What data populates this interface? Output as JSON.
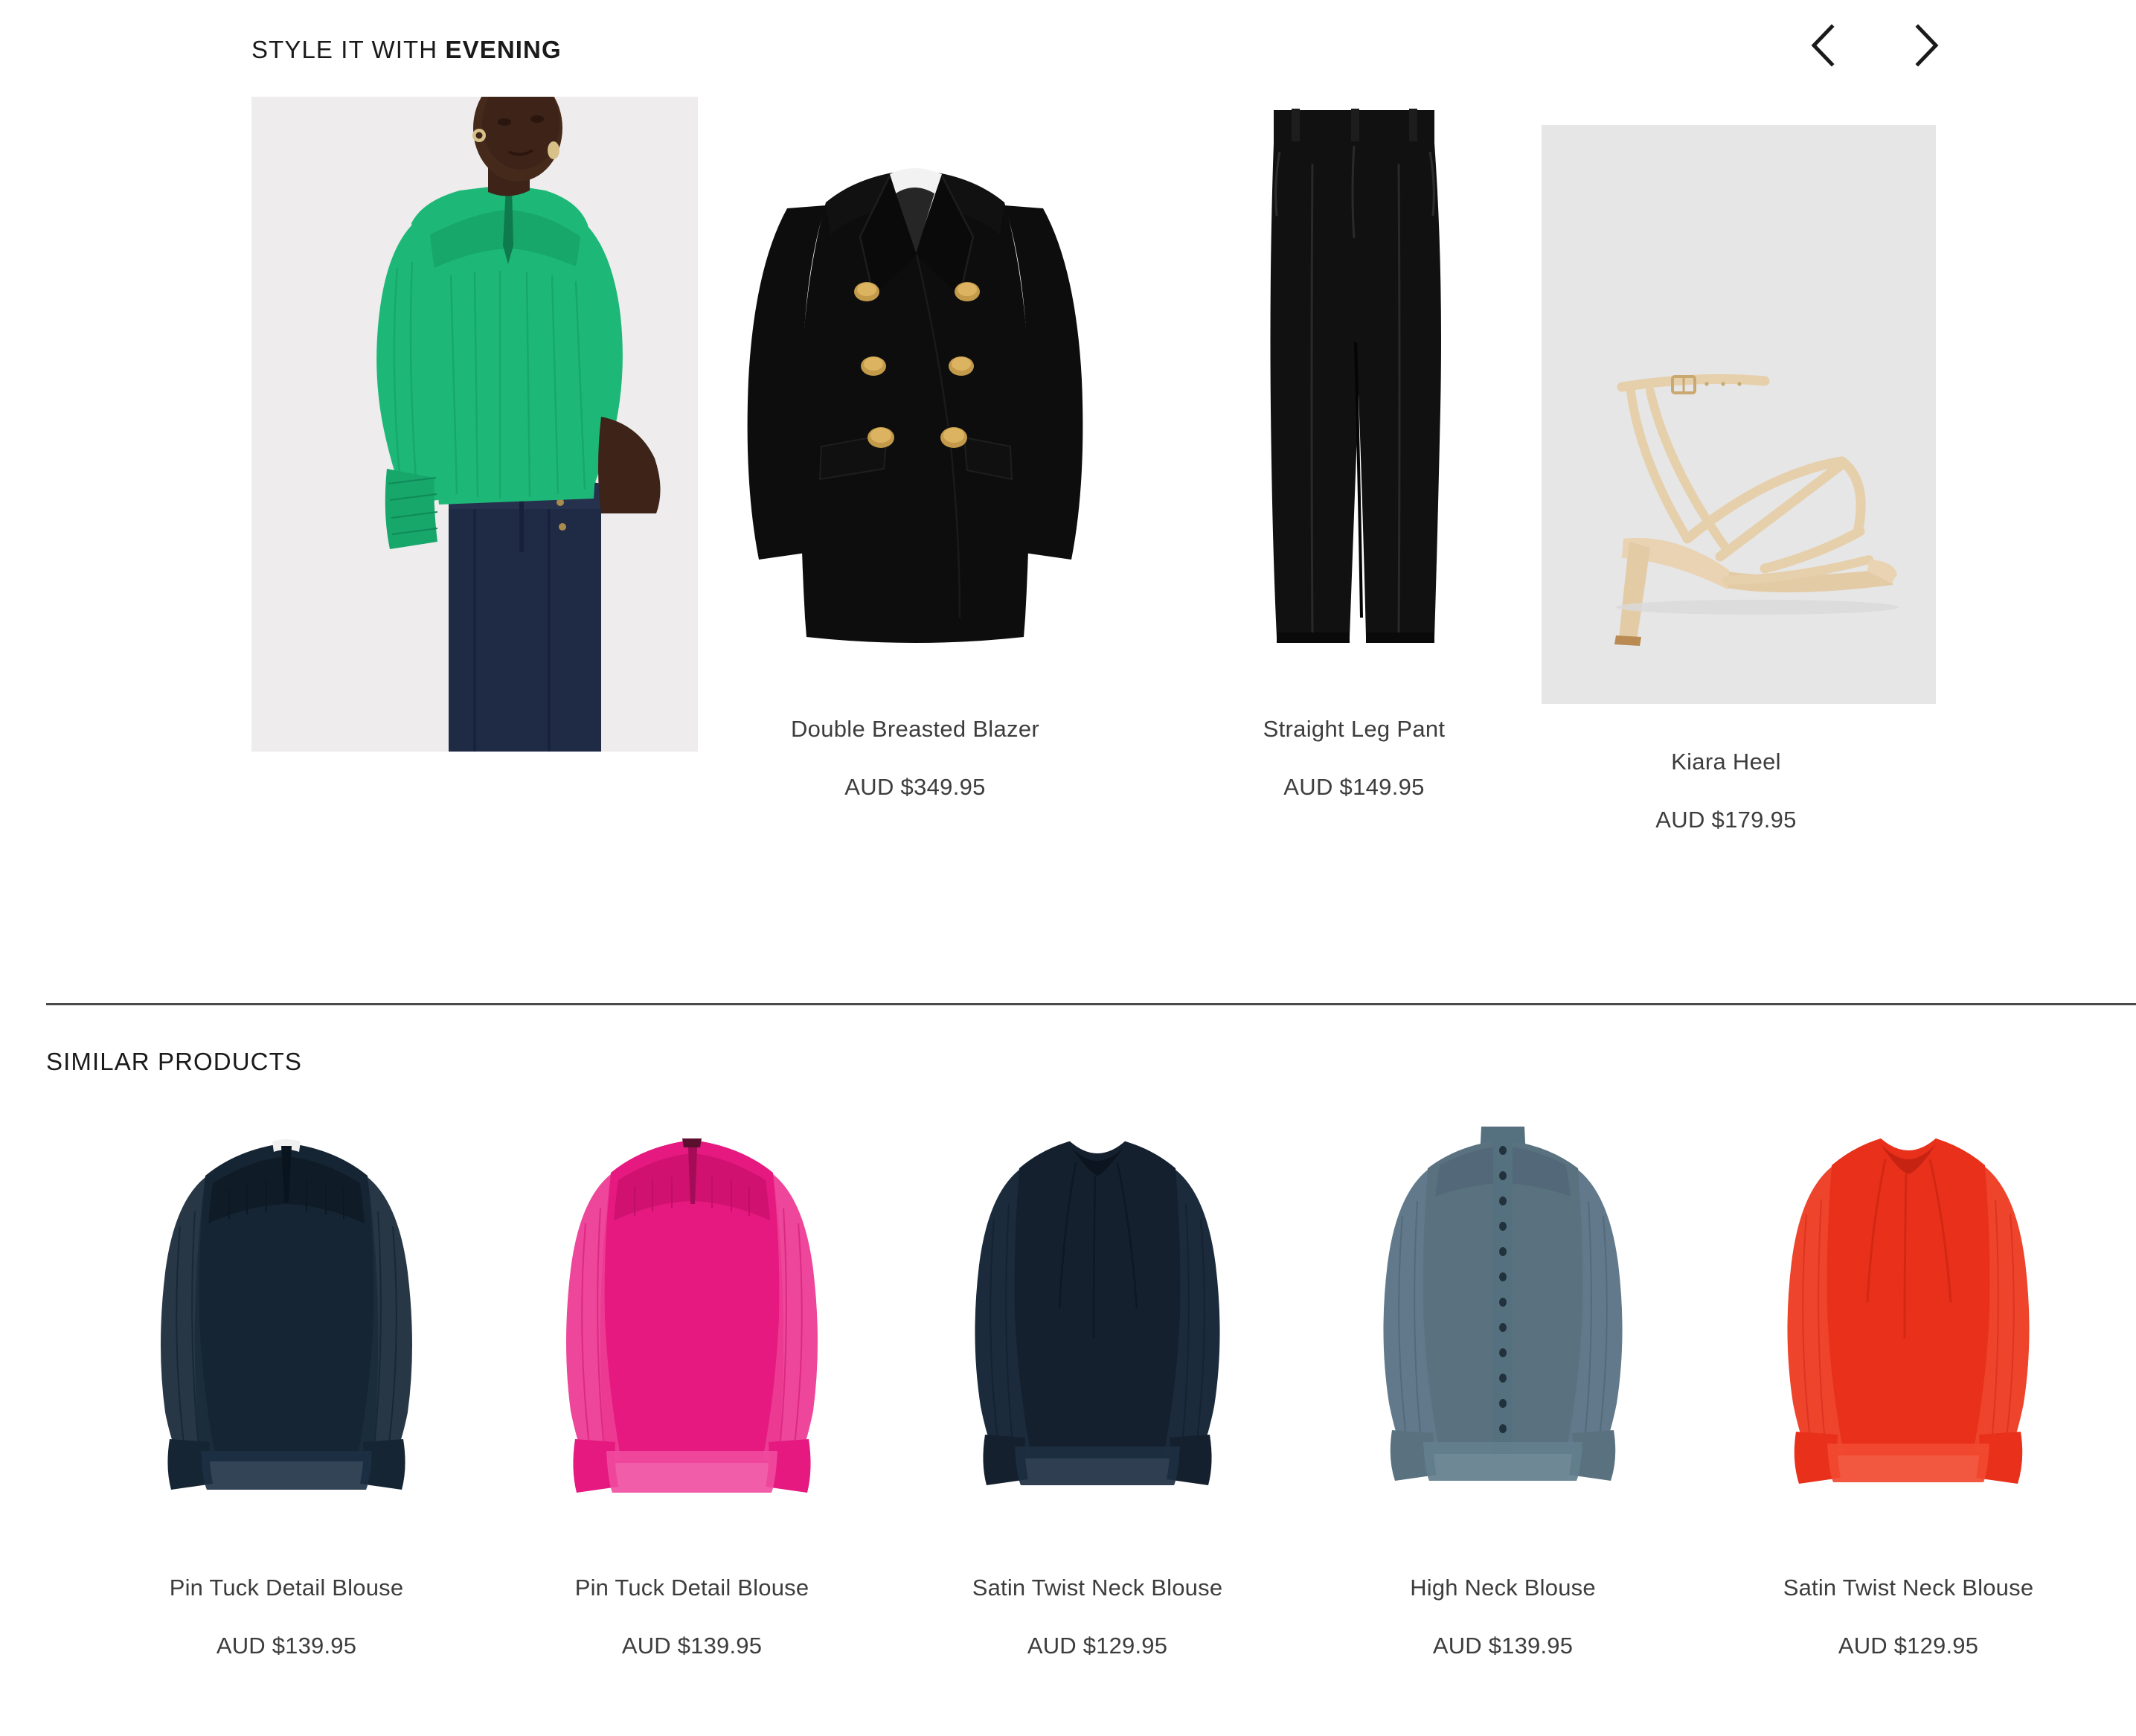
{
  "style_it_with": {
    "heading_prefix": "STYLE IT WITH ",
    "heading_accent": "EVENING",
    "nav": {
      "prev_icon": "chevron-left-icon",
      "next_icon": "chevron-right-icon"
    },
    "hero": {
      "alt_label": "Model wearing green blouse and dark denim jeans",
      "blouse_color": "#1db878",
      "denim_color": "#1f2a44",
      "background": "#eeecec"
    },
    "products": [
      {
        "name": "Double Breasted Blazer",
        "price": "AUD $349.95",
        "image_label": "black-double-breasted-blazer",
        "color": "#0d0d0d",
        "accent_color": "#c29a4a",
        "background": "#ffffff"
      },
      {
        "name": "Straight Leg Pant",
        "price": "AUD $149.95",
        "image_label": "black-straight-leg-pant",
        "color": "#111111",
        "accent_color": "#111111",
        "background": "#ffffff"
      },
      {
        "name": "Kiara Heel",
        "price": "AUD $179.95",
        "image_label": "nude-strappy-heel",
        "color": "#e8d5b8",
        "accent_color": "#c9a97e",
        "background": "#e6e6e6"
      }
    ]
  },
  "similar_products": {
    "heading": "SIMILAR PRODUCTS",
    "items": [
      {
        "name": "Pin Tuck Detail Blouse",
        "price": "AUD $139.95",
        "image_label": "navy-pin-tuck-detail-blouse",
        "color": "#152533"
      },
      {
        "name": "Pin Tuck Detail Blouse",
        "price": "AUD $139.95",
        "image_label": "pink-pin-tuck-detail-blouse",
        "color": "#e5197f"
      },
      {
        "name": "Satin Twist Neck Blouse",
        "price": "AUD $129.95",
        "image_label": "navy-satin-twist-neck-blouse",
        "color": "#15202e"
      },
      {
        "name": "High Neck Blouse",
        "price": "AUD $139.95",
        "image_label": "slate-high-neck-blouse",
        "color": "#5a7280"
      },
      {
        "name": "Satin Twist Neck Blouse",
        "price": "AUD $129.95",
        "image_label": "red-satin-twist-neck-blouse",
        "color": "#e8301a"
      }
    ]
  }
}
